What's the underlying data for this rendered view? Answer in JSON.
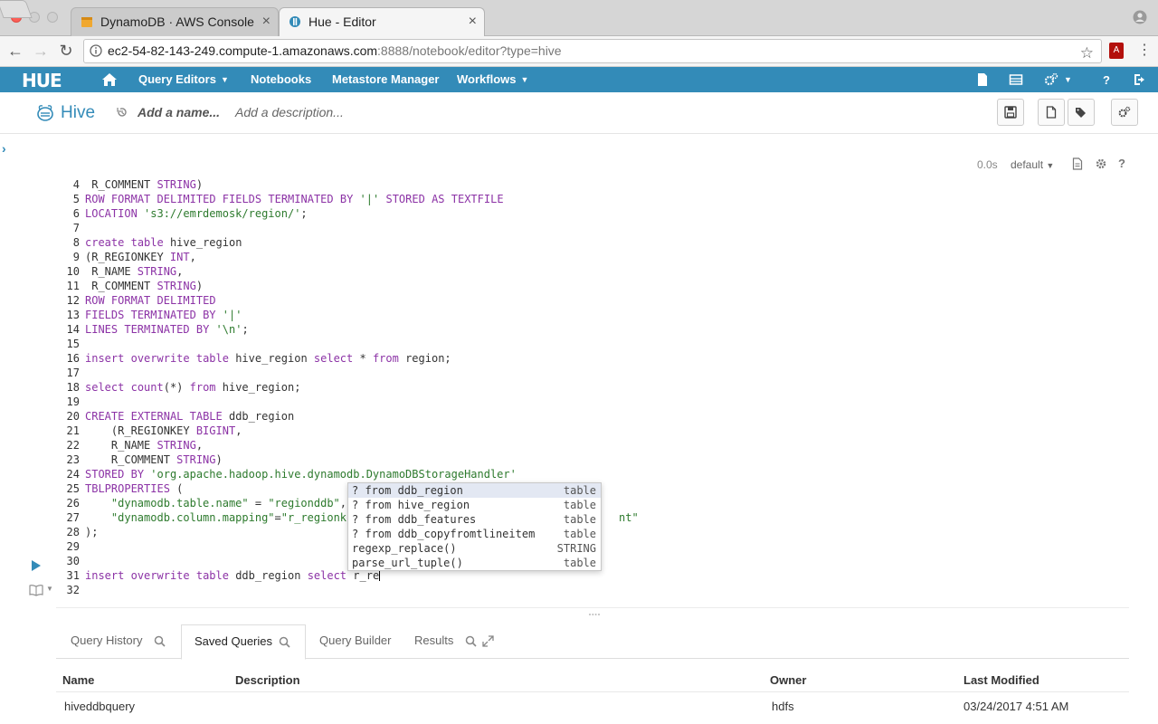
{
  "browser": {
    "tabs": [
      {
        "label": "DynamoDB · AWS Console"
      },
      {
        "label": "Hue - Editor"
      }
    ],
    "url_host": "ec2-54-82-143-249.compute-1.amazonaws.com",
    "url_rest": ":8888/notebook/editor?type=hive"
  },
  "nav": {
    "logo": "HUE",
    "items": [
      "Query Editors",
      "Notebooks",
      "Metastore Manager",
      "Workflows"
    ]
  },
  "editor": {
    "type": "Hive",
    "name_placeholder": "Add a name...",
    "desc_placeholder": "Add a description...",
    "exec_time": "0.0s",
    "database": "default"
  },
  "code": {
    "lines": [
      {
        "n": "4",
        "t": " R_COMMENT STRING)"
      },
      {
        "n": "5",
        "t": "ROW FORMAT DELIMITED FIELDS TERMINATED BY '|' STORED AS TEXTFILE"
      },
      {
        "n": "6",
        "t": "LOCATION 's3://emrdemosk/region/';"
      },
      {
        "n": "7",
        "t": ""
      },
      {
        "n": "8",
        "t": "create table hive_region"
      },
      {
        "n": "9",
        "t": "(R_REGIONKEY INT,"
      },
      {
        "n": "10",
        "t": " R_NAME STRING,"
      },
      {
        "n": "11",
        "t": " R_COMMENT STRING)"
      },
      {
        "n": "12",
        "t": "ROW FORMAT DELIMITED"
      },
      {
        "n": "13",
        "t": "FIELDS TERMINATED BY '|'"
      },
      {
        "n": "14",
        "t": "LINES TERMINATED BY '\\n';"
      },
      {
        "n": "15",
        "t": ""
      },
      {
        "n": "16",
        "t": "insert overwrite table hive_region select * from region;"
      },
      {
        "n": "17",
        "t": ""
      },
      {
        "n": "18",
        "t": "select count(*) from hive_region;"
      },
      {
        "n": "19",
        "t": ""
      },
      {
        "n": "20",
        "t": "CREATE EXTERNAL TABLE ddb_region"
      },
      {
        "n": "21",
        "t": "    (R_REGIONKEY BIGINT,"
      },
      {
        "n": "22",
        "t": "    R_NAME STRING,"
      },
      {
        "n": "23",
        "t": "    R_COMMENT STRING)"
      },
      {
        "n": "24",
        "t": "STORED BY 'org.apache.hadoop.hive.dynamodb.DynamoDBStorageHandler'"
      },
      {
        "n": "25",
        "t": "TBLPROPERTIES ("
      },
      {
        "n": "26",
        "t": "    \"dynamodb.table.name\" = \"regionddb\","
      },
      {
        "n": "27",
        "t": "    \"dynamodb.column.mapping\"=\"r_regionk"
      },
      {
        "n": "28",
        "t": ");"
      },
      {
        "n": "29",
        "t": ""
      },
      {
        "n": "30",
        "t": ""
      },
      {
        "n": "31",
        "t": "insert overwrite table ddb_region select r_re"
      },
      {
        "n": "32",
        "t": ""
      }
    ],
    "line27_tail": "nt\""
  },
  "autocomplete": [
    {
      "label": "? from ddb_region",
      "meta": "table"
    },
    {
      "label": "? from hive_region",
      "meta": "table"
    },
    {
      "label": "? from ddb_features",
      "meta": "table"
    },
    {
      "label": "? from ddb_copyfromtlineitem",
      "meta": "table"
    },
    {
      "label": "regexp_replace()",
      "meta": "STRING"
    },
    {
      "label": "parse_url_tuple()",
      "meta": "table"
    }
  ],
  "bottom_tabs": [
    "Query History",
    "Saved Queries",
    "Query Builder",
    "Results"
  ],
  "saved_queries": {
    "headers": [
      "Name",
      "Description",
      "Owner",
      "Last Modified"
    ],
    "rows": [
      {
        "name": "hiveddbquery",
        "description": "",
        "owner": "hdfs",
        "modified": "03/24/2017 4:51 AM"
      }
    ]
  }
}
